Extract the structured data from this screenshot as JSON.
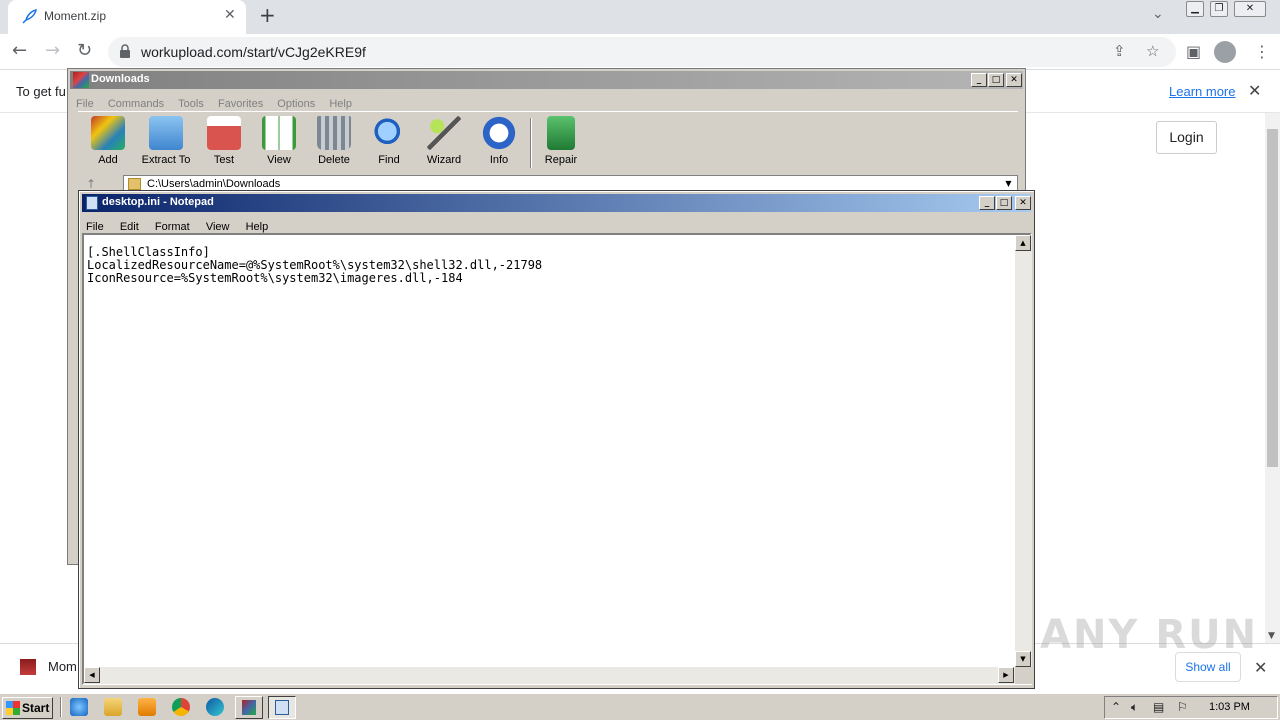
{
  "browser": {
    "tab_title": "Moment.zip",
    "url": "workupload.com/start/vCJg2eKRE9f",
    "infobar_text": "To get fu",
    "learn_more": "Learn more",
    "login_label": "Login",
    "download_item": "Mom",
    "show_all": "Show all",
    "new_tab_symbol": "+",
    "close_symbol": "✕"
  },
  "winrar": {
    "title": "Downloads",
    "menu": [
      "File",
      "Commands",
      "Tools",
      "Favorites",
      "Options",
      "Help"
    ],
    "tools": [
      {
        "label": "Add",
        "icon": "add-archive-icon",
        "color": "#c0392b"
      },
      {
        "label": "Extract To",
        "icon": "extract-folder-icon",
        "color": "#5aa0e0"
      },
      {
        "label": "Test",
        "icon": "test-clipboard-icon",
        "color": "#d9534f"
      },
      {
        "label": "View",
        "icon": "view-book-icon",
        "color": "#3c9a3c"
      },
      {
        "label": "Delete",
        "icon": "delete-trash-icon",
        "color": "#9aa3ad"
      },
      {
        "label": "Find",
        "icon": "find-magnifier-icon",
        "color": "#2b6fd1"
      },
      {
        "label": "Wizard",
        "icon": "wizard-wand-icon",
        "color": "#7fbf3f"
      },
      {
        "label": "Info",
        "icon": "info-icon",
        "color": "#2c63c7"
      },
      {
        "label": "Repair",
        "icon": "repair-icon",
        "color": "#2e9d46"
      }
    ],
    "path": "C:\\Users\\admin\\Downloads"
  },
  "notepad": {
    "title": "desktop.ini - Notepad",
    "menu": [
      "File",
      "Edit",
      "Format",
      "View",
      "Help"
    ],
    "content": "[.ShellClassInfo]\nLocalizedResourceName=@%SystemRoot%\\system32\\shell32.dll,-21798\nIconResource=%SystemRoot%\\system32\\imageres.dll,-184"
  },
  "taskbar": {
    "start_label": "Start",
    "clock": "1:03 PM"
  },
  "watermark": "ANY RUN"
}
